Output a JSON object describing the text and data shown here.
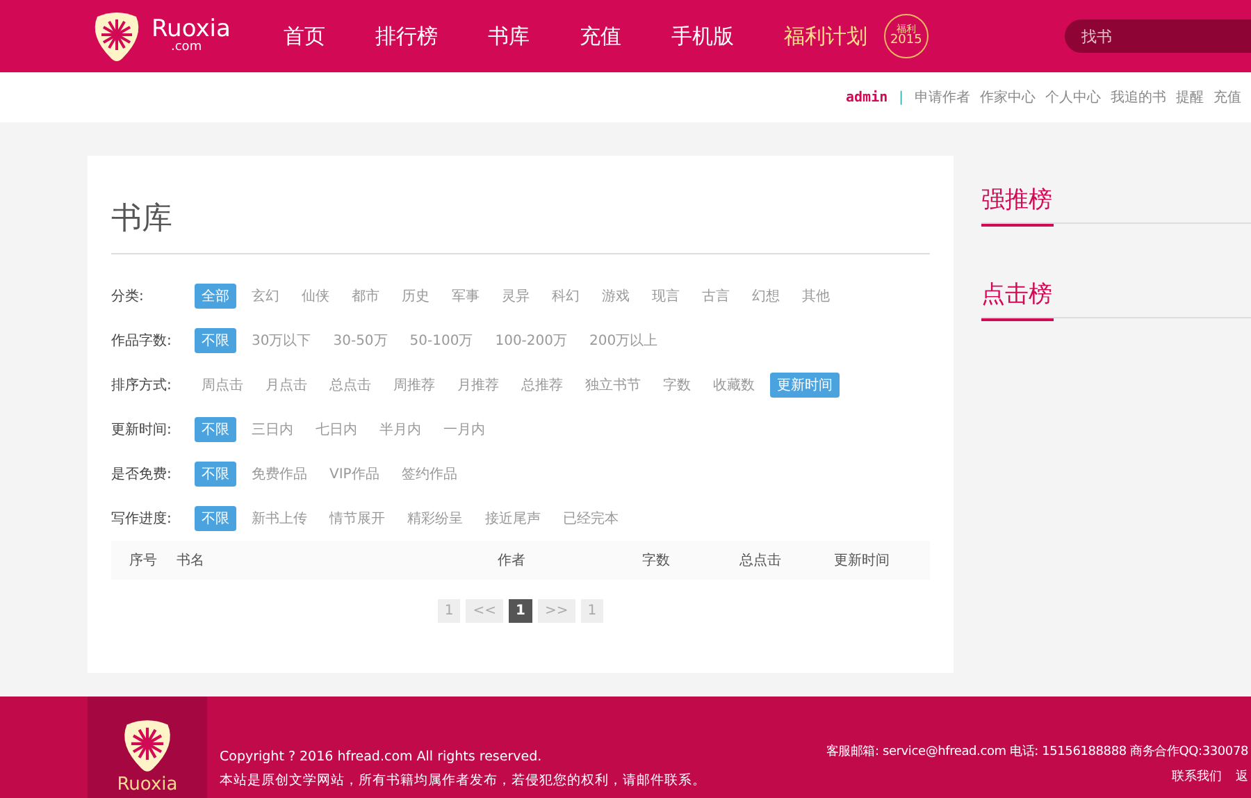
{
  "header": {
    "logo_text": "Ruoxia",
    "logo_sub": ".com",
    "nav": [
      {
        "label": "首页",
        "kind": "normal"
      },
      {
        "label": "排行榜",
        "kind": "normal"
      },
      {
        "label": "书库",
        "kind": "normal"
      },
      {
        "label": "充值",
        "kind": "normal"
      },
      {
        "label": "手机版",
        "kind": "normal"
      },
      {
        "label": "福利计划",
        "kind": "highlight"
      }
    ],
    "badge": {
      "top": "福利",
      "year": "2015"
    },
    "search": {
      "placeholder": "找书"
    }
  },
  "user_bar": {
    "user": "admin",
    "separator": "|",
    "links": [
      "申请作者",
      "作家中心",
      "个人中心",
      "我追的书",
      "提醒",
      "充值"
    ]
  },
  "library": {
    "title": "书库",
    "filters": [
      {
        "label": "分类:",
        "options": [
          {
            "label": "全部",
            "selected": true
          },
          {
            "label": "玄幻",
            "selected": false
          },
          {
            "label": "仙侠",
            "selected": false
          },
          {
            "label": "都市",
            "selected": false
          },
          {
            "label": "历史",
            "selected": false
          },
          {
            "label": "军事",
            "selected": false
          },
          {
            "label": "灵异",
            "selected": false
          },
          {
            "label": "科幻",
            "selected": false
          },
          {
            "label": "游戏",
            "selected": false
          },
          {
            "label": "现言",
            "selected": false
          },
          {
            "label": "古言",
            "selected": false
          },
          {
            "label": "幻想",
            "selected": false
          },
          {
            "label": "其他",
            "selected": false
          }
        ]
      },
      {
        "label": "作品字数:",
        "options": [
          {
            "label": "不限",
            "selected": true
          },
          {
            "label": "30万以下",
            "selected": false
          },
          {
            "label": "30-50万",
            "selected": false
          },
          {
            "label": "50-100万",
            "selected": false
          },
          {
            "label": "100-200万",
            "selected": false
          },
          {
            "label": "200万以上",
            "selected": false
          }
        ]
      },
      {
        "label": "排序方式:",
        "options": [
          {
            "label": "周点击",
            "selected": false
          },
          {
            "label": "月点击",
            "selected": false
          },
          {
            "label": "总点击",
            "selected": false
          },
          {
            "label": "周推荐",
            "selected": false
          },
          {
            "label": "月推荐",
            "selected": false
          },
          {
            "label": "总推荐",
            "selected": false
          },
          {
            "label": "独立书节",
            "selected": false
          },
          {
            "label": "字数",
            "selected": false
          },
          {
            "label": "收藏数",
            "selected": false
          },
          {
            "label": "更新时间",
            "selected": true
          }
        ]
      },
      {
        "label": "更新时间:",
        "options": [
          {
            "label": "不限",
            "selected": true
          },
          {
            "label": "三日内",
            "selected": false
          },
          {
            "label": "七日内",
            "selected": false
          },
          {
            "label": "半月内",
            "selected": false
          },
          {
            "label": "一月内",
            "selected": false
          }
        ]
      },
      {
        "label": "是否免费:",
        "options": [
          {
            "label": "不限",
            "selected": true
          },
          {
            "label": "免费作品",
            "selected": false
          },
          {
            "label": "VIP作品",
            "selected": false
          },
          {
            "label": "签约作品",
            "selected": false
          }
        ]
      },
      {
        "label": "写作进度:",
        "options": [
          {
            "label": "不限",
            "selected": true
          },
          {
            "label": "新书上传",
            "selected": false
          },
          {
            "label": "情节展开",
            "selected": false
          },
          {
            "label": "精彩纷呈",
            "selected": false
          },
          {
            "label": "接近尾声",
            "selected": false
          },
          {
            "label": "已经完本",
            "selected": false
          }
        ]
      }
    ],
    "table": {
      "columns": [
        "序号",
        "书名",
        "作者",
        "字数",
        "总点击",
        "更新时间"
      ]
    },
    "pagination": [
      {
        "label": "1",
        "selected": false
      },
      {
        "label": "<<",
        "selected": false
      },
      {
        "label": "1",
        "selected": true
      },
      {
        "label": ">>",
        "selected": false
      },
      {
        "label": "1",
        "selected": false
      }
    ]
  },
  "sidebar": {
    "sections": [
      "强推榜",
      "点击榜"
    ]
  },
  "footer": {
    "logo_text": "Ruoxia",
    "copyright": "Copyright ? 2016 hfread.com All rights reserved.",
    "notice": "本站是原创文学网站，所有书籍均属作者发布，若侵犯您的权利，请邮件联系。",
    "contact": "客服邮箱: service@hfread.com  电话: 15156188888  商务合作QQ:330078",
    "links": [
      "联系我们",
      "返"
    ]
  }
}
